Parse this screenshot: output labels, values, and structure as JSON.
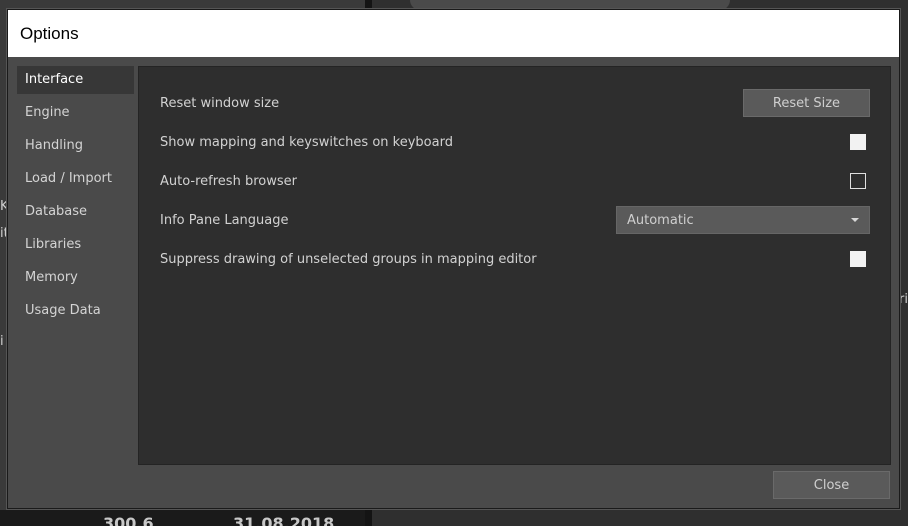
{
  "dialog": {
    "title": "Options",
    "close_label": "Close"
  },
  "sidebar": {
    "items": [
      {
        "label": "Interface",
        "active": true
      },
      {
        "label": "Engine"
      },
      {
        "label": "Handling"
      },
      {
        "label": "Load / Import"
      },
      {
        "label": "Database"
      },
      {
        "label": "Libraries"
      },
      {
        "label": "Memory"
      },
      {
        "label": "Usage Data"
      }
    ]
  },
  "interface": {
    "reset_window": {
      "label": "Reset window size",
      "button": "Reset Size"
    },
    "show_mapping": {
      "label": "Show mapping and keyswitches on keyboard",
      "checked": true
    },
    "auto_refresh": {
      "label": "Auto-refresh browser",
      "checked": false
    },
    "info_pane_language": {
      "label": "Info Pane Language",
      "value": "Automatic"
    },
    "suppress_drawing": {
      "label": "Suppress drawing of unselected groups in mapping editor",
      "checked": true
    }
  },
  "background": {
    "fragments": [
      "K",
      "it",
      "i",
      "ri"
    ],
    "footer_left": "300.6",
    "footer_right": "31.08.2018"
  },
  "colors": {
    "titlebar": "#ffffff",
    "dialog_bg": "#4a4a4a",
    "panel_bg": "#2e2e2e",
    "button_bg": "#5a5a5a",
    "text": "#d2d2d2"
  }
}
